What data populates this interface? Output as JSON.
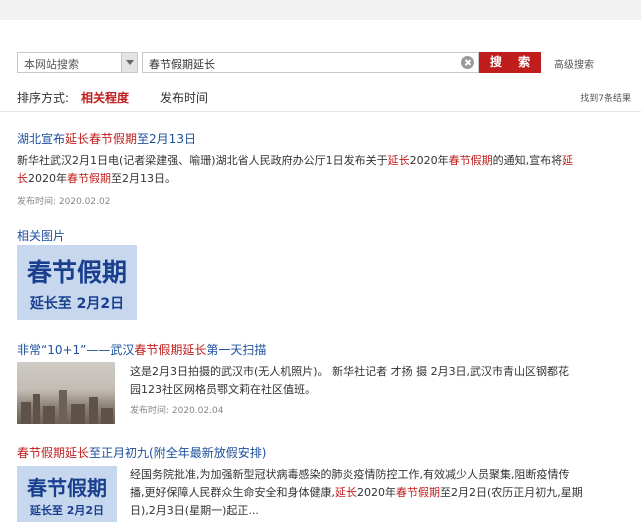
{
  "search": {
    "scope": "本网站搜索",
    "query": "春节假期延长",
    "button_label": "搜 索",
    "advanced": "高级搜索"
  },
  "sort": {
    "label": "排序方式:",
    "relevance": "相关程度",
    "time": "发布时间",
    "found": "找到7条结果"
  },
  "results": [
    {
      "title_parts": [
        "湖北宣布",
        "延长",
        "春节假期",
        "至2月13日"
      ],
      "snippet_line1": [
        "新华社武汉2月1日电(记者梁建强、喻珊)湖北省人民政府办公厅1日发布关于",
        "延长",
        "2020年",
        "春节假期",
        "的通知,宣布将",
        "延"
      ],
      "snippet_line2": [
        "长",
        "2020年",
        "春节假期",
        "至2月13日。"
      ],
      "date": "发布时间: 2020.02.02"
    },
    {
      "title_parts": [
        "非常“10+1”——武汉",
        "春节假期延长",
        "第一天扫描"
      ],
      "snippet_line1": "这是2月3日拍摄的武汉市(无人机照片)。 新华社记者 才扬 摄 2月3日,武汉市青山区钢都花",
      "snippet_line2": "园123社区网格员鄂文莉在社区值班。",
      "date": "发布时间: 2020.02.04"
    },
    {
      "title_parts": [
        "春节假期延长",
        "至正月初九(附全年最新放假安排)"
      ],
      "snippet_line1": "经国务院批准,为加强新型冠状病毒感染的肺炎疫情防控工作,有效减少人员聚集,阻断疫情传",
      "snippet_line2": [
        "播,更好保障人民群众生命安全和身体健康,",
        "延长",
        "2020年",
        "春节假期",
        "至2月2日(农历正月初九,星期"
      ],
      "snippet_line3": "日),2月3日(星期一)起正..."
    }
  ],
  "related_images_label": "相关图片",
  "banner": {
    "line1": "春节假期",
    "line2": "延长至 2月2日"
  },
  "colors": {
    "accent_red": "#c01d1d",
    "link_blue": "#1c4f9c",
    "banner_bg": "#c7d8ee"
  }
}
